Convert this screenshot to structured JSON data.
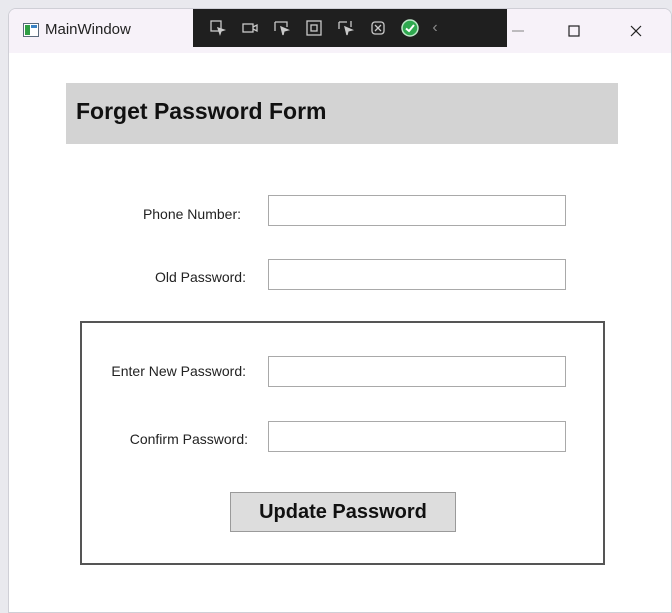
{
  "window": {
    "title": "MainWindow"
  },
  "toolbar": {
    "tools": [
      {
        "icon": "select-element-icon"
      },
      {
        "icon": "video-icon"
      },
      {
        "icon": "cursor-select-icon"
      },
      {
        "icon": "layout-adorner-icon"
      },
      {
        "icon": "track-focus-icon"
      },
      {
        "icon": "binding-failures-icon"
      },
      {
        "icon": "check-circle-icon"
      },
      {
        "icon": "chevron-left-icon"
      }
    ],
    "accent_color": "#2fa84f"
  },
  "form": {
    "title": "Forget Password Form",
    "phone_label": "Phone Number:",
    "phone_value": "",
    "old_password_label": "Old Password:",
    "old_password_value": "",
    "new_password_label": "Enter New Password:",
    "new_password_value": "",
    "confirm_password_label": "Confirm  Password:",
    "confirm_password_value": "",
    "update_button_label": "Update Password"
  }
}
